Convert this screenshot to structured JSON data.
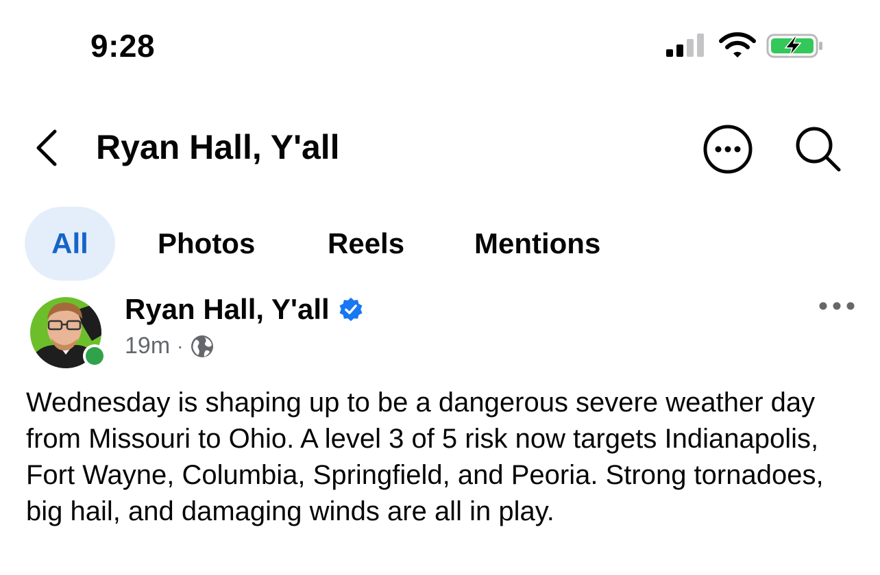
{
  "status_bar": {
    "time": "9:28",
    "signal_icon": "cellular-signal-icon",
    "wifi_icon": "wifi-icon",
    "battery_icon": "battery-charging-icon",
    "battery_color": "#34c759"
  },
  "header": {
    "back_icon": "chevron-left-icon",
    "title": "Ryan Hall, Y'all",
    "more_icon": "more-circle-icon",
    "search_icon": "search-icon"
  },
  "tabs": [
    {
      "label": "All",
      "selected": true
    },
    {
      "label": "Photos",
      "selected": false
    },
    {
      "label": "Reels",
      "selected": false
    },
    {
      "label": "Mentions",
      "selected": false
    }
  ],
  "post": {
    "author": "Ryan Hall, Y'all",
    "verified": true,
    "time": "19m",
    "separator": "·",
    "audience_icon": "globe-icon",
    "online": true,
    "text": "Wednesday is shaping up to be a dangerous severe weather day from Missouri to Ohio. A level 3 of 5 risk now targets Indianapolis, Fort Wayne, Columbia, Springfield, and Peoria. Strong tornadoes, big hail, and damaging winds are all in play."
  },
  "colors": {
    "accent": "#1565c8",
    "tab_selected_bg": "#e4eefb",
    "verified": "#1877f2",
    "online": "#31a24c",
    "muted_text": "#65676b"
  }
}
